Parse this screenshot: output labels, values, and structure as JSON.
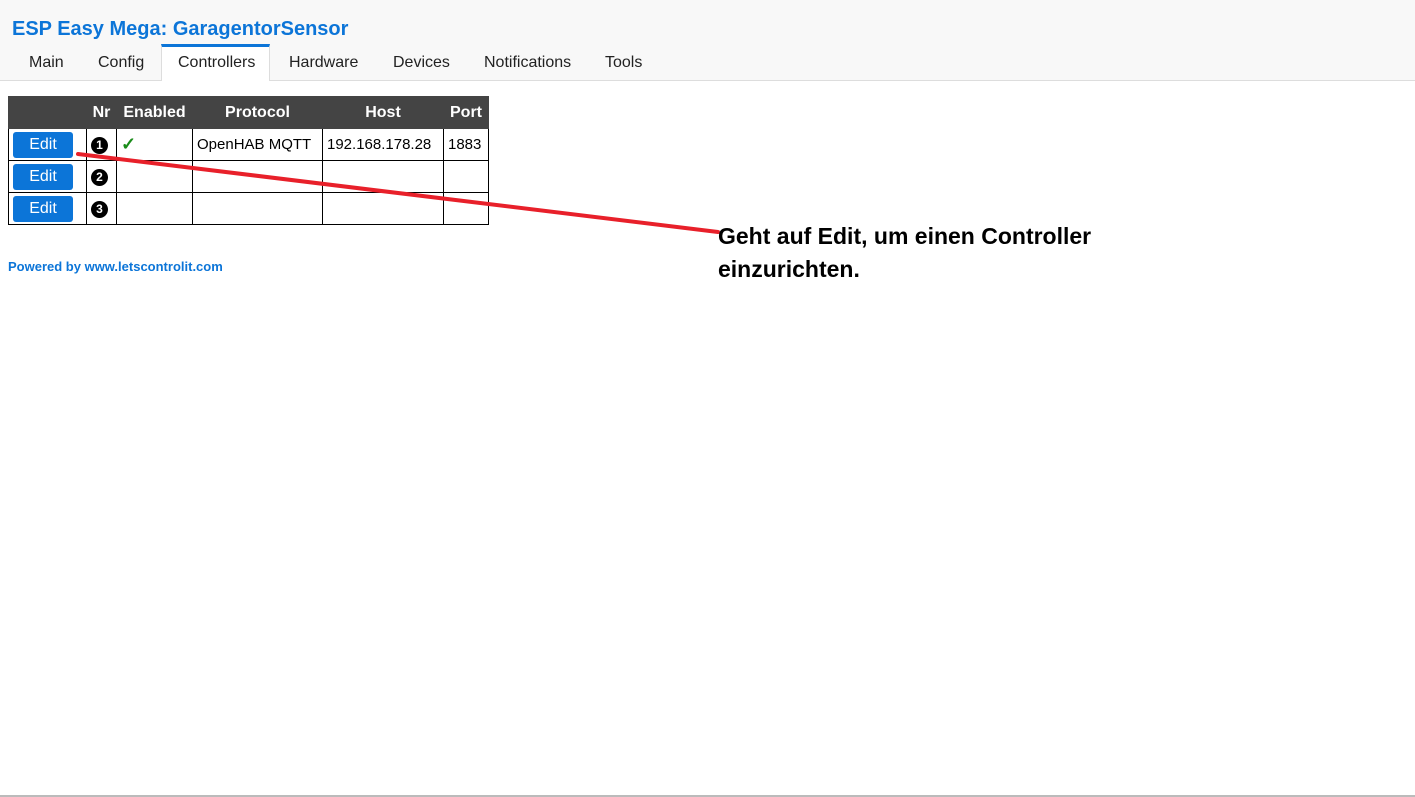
{
  "header": {
    "title": "ESP Easy Mega: GaragentorSensor",
    "accent_color": "#0c75d8"
  },
  "tabs": [
    {
      "label": "Main"
    },
    {
      "label": "Config"
    },
    {
      "label": "Controllers",
      "active": true
    },
    {
      "label": "Hardware"
    },
    {
      "label": "Devices"
    },
    {
      "label": "Notifications"
    },
    {
      "label": "Tools"
    }
  ],
  "controllers_table": {
    "columns": [
      "",
      "Nr",
      "Enabled",
      "Protocol",
      "Host",
      "Port"
    ],
    "rows": [
      {
        "edit": "Edit",
        "nr": "1",
        "enabled": "✓",
        "protocol": "OpenHAB MQTT",
        "host": "192.168.178.28",
        "port": "1883"
      },
      {
        "edit": "Edit",
        "nr": "2",
        "enabled": "",
        "protocol": "",
        "host": "",
        "port": ""
      },
      {
        "edit": "Edit",
        "nr": "3",
        "enabled": "",
        "protocol": "",
        "host": "",
        "port": ""
      }
    ]
  },
  "footer": {
    "powered_by": "Powered by www.letscontrolit.com"
  },
  "annotation": {
    "text": "Geht auf Edit, um einen Controller einzurichten.",
    "line_color": "#e8202a"
  }
}
